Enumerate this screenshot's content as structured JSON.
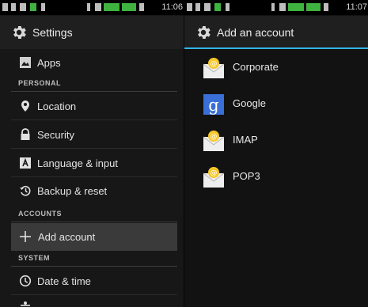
{
  "left": {
    "status": {
      "time": "11:06"
    },
    "title": "Settings",
    "items": [
      {
        "label": "Apps",
        "icon": "apps-icon"
      },
      {
        "label": "Location",
        "icon": "location-pin-icon"
      },
      {
        "label": "Security",
        "icon": "lock-icon"
      },
      {
        "label": "Language & input",
        "icon": "keyboard-a-icon"
      },
      {
        "label": "Backup & reset",
        "icon": "backup-reset-icon"
      },
      {
        "label": "Add account",
        "icon": "plus-icon",
        "selected": true
      },
      {
        "label": "Date & time",
        "icon": "clock-icon"
      }
    ],
    "headers": [
      "PERSONAL",
      "ACCOUNTS",
      "SYSTEM"
    ]
  },
  "right": {
    "status": {
      "time": "11:07"
    },
    "title": "Add an account",
    "accounts": [
      {
        "label": "Corporate",
        "icon": "corporate-mail-icon"
      },
      {
        "label": "Google",
        "icon": "google-icon"
      },
      {
        "label": "IMAP",
        "icon": "imap-mail-icon"
      },
      {
        "label": "POP3",
        "icon": "pop3-mail-icon"
      }
    ]
  },
  "colors": {
    "accent": "#33b5e5",
    "selected_row": "#3a3a3a",
    "google_blue": "#3a6fd8"
  }
}
